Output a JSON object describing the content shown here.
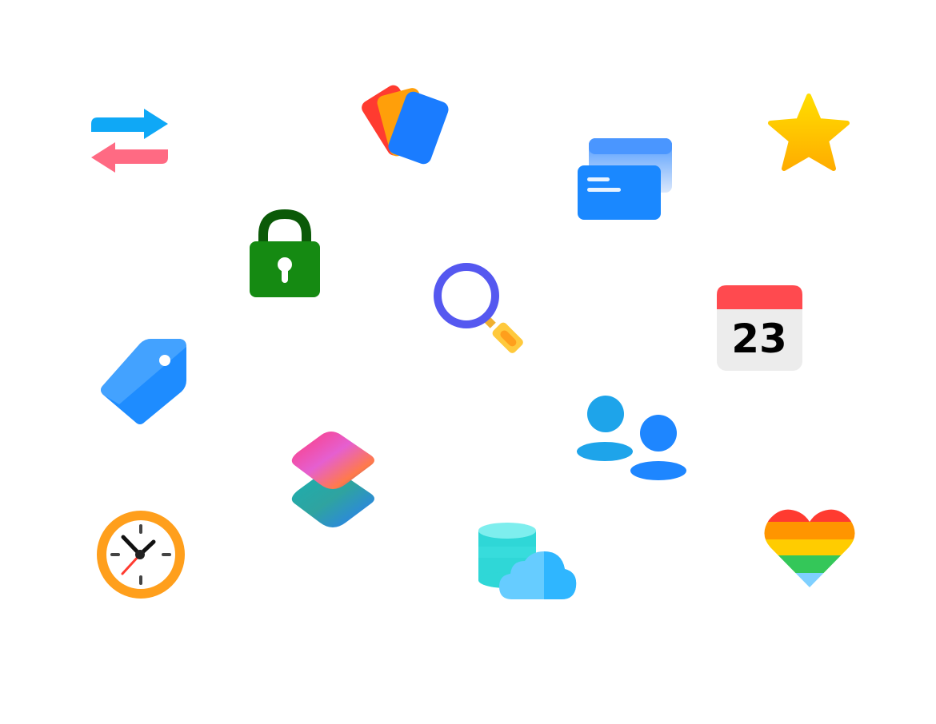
{
  "icons": [
    {
      "name": "swap-arrows-icon"
    },
    {
      "name": "wallet-cards-icon"
    },
    {
      "name": "credit-cards-icon"
    },
    {
      "name": "star-icon"
    },
    {
      "name": "lock-icon"
    },
    {
      "name": "search-icon"
    },
    {
      "name": "calendar-icon"
    },
    {
      "name": "tag-icon"
    },
    {
      "name": "users-icon"
    },
    {
      "name": "shortcuts-icon"
    },
    {
      "name": "clock-icon"
    },
    {
      "name": "cloud-database-icon"
    },
    {
      "name": "rainbow-heart-icon"
    }
  ],
  "calendar": {
    "day": "23"
  },
  "colors": {
    "background": "#ffffff",
    "swap_top": "#0fa8f6",
    "swap_bottom": "#ff6a83",
    "lock_body": "#158a12",
    "lock_shackle": "#0b5a08",
    "search_ring": "#5558f0",
    "search_handle": "#ffc93c",
    "calendar_header": "#ff4a4f",
    "calendar_body": "#ececec",
    "tag": "#1e8cff",
    "user_left": "#1ea4ea",
    "user_right": "#1e86ff",
    "clock_ring": "#ff9f1c",
    "clock_hand_red": "#ff3b30",
    "star_top": "#ffd700",
    "star_bottom": "#ffb000",
    "card_front": "#1a88ff",
    "card_back": "#4a9eff",
    "heart_red": "#ff3b30",
    "heart_orange": "#ff9500",
    "heart_yellow": "#ffcc00",
    "heart_green": "#34c759",
    "heart_blue": "#7fd0ff",
    "db_teal": "#2fd7d7",
    "cloud_blue": "#2fb6ff"
  }
}
